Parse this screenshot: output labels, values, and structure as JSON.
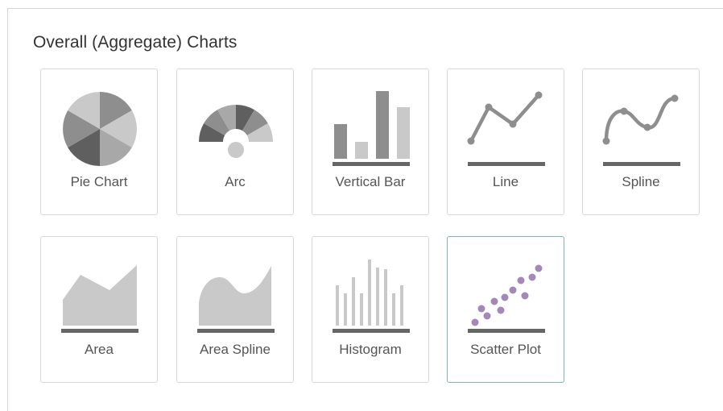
{
  "section": {
    "title": "Overall (Aggregate) Charts"
  },
  "colors": {
    "dark_gray": "#5f5f5f",
    "mid_gray": "#8e8e8e",
    "light_gray": "#c9c9c9",
    "axis": "#666666",
    "scatter_purple": "#a489b8",
    "selected_border": "#7fb2c8"
  },
  "tiles": [
    {
      "label": "Pie Chart",
      "icon": "pie-chart-icon",
      "selected": false
    },
    {
      "label": "Arc",
      "icon": "arc-chart-icon",
      "selected": false
    },
    {
      "label": "Vertical Bar",
      "icon": "vertical-bar-chart-icon",
      "selected": false
    },
    {
      "label": "Line",
      "icon": "line-chart-icon",
      "selected": false
    },
    {
      "label": "Spline",
      "icon": "spline-chart-icon",
      "selected": false
    },
    {
      "label": "Area",
      "icon": "area-chart-icon",
      "selected": false
    },
    {
      "label": "Area Spline",
      "icon": "area-spline-chart-icon",
      "selected": false
    },
    {
      "label": "Histogram",
      "icon": "histogram-chart-icon",
      "selected": false
    },
    {
      "label": "Scatter Plot",
      "icon": "scatter-plot-icon",
      "selected": true
    }
  ]
}
